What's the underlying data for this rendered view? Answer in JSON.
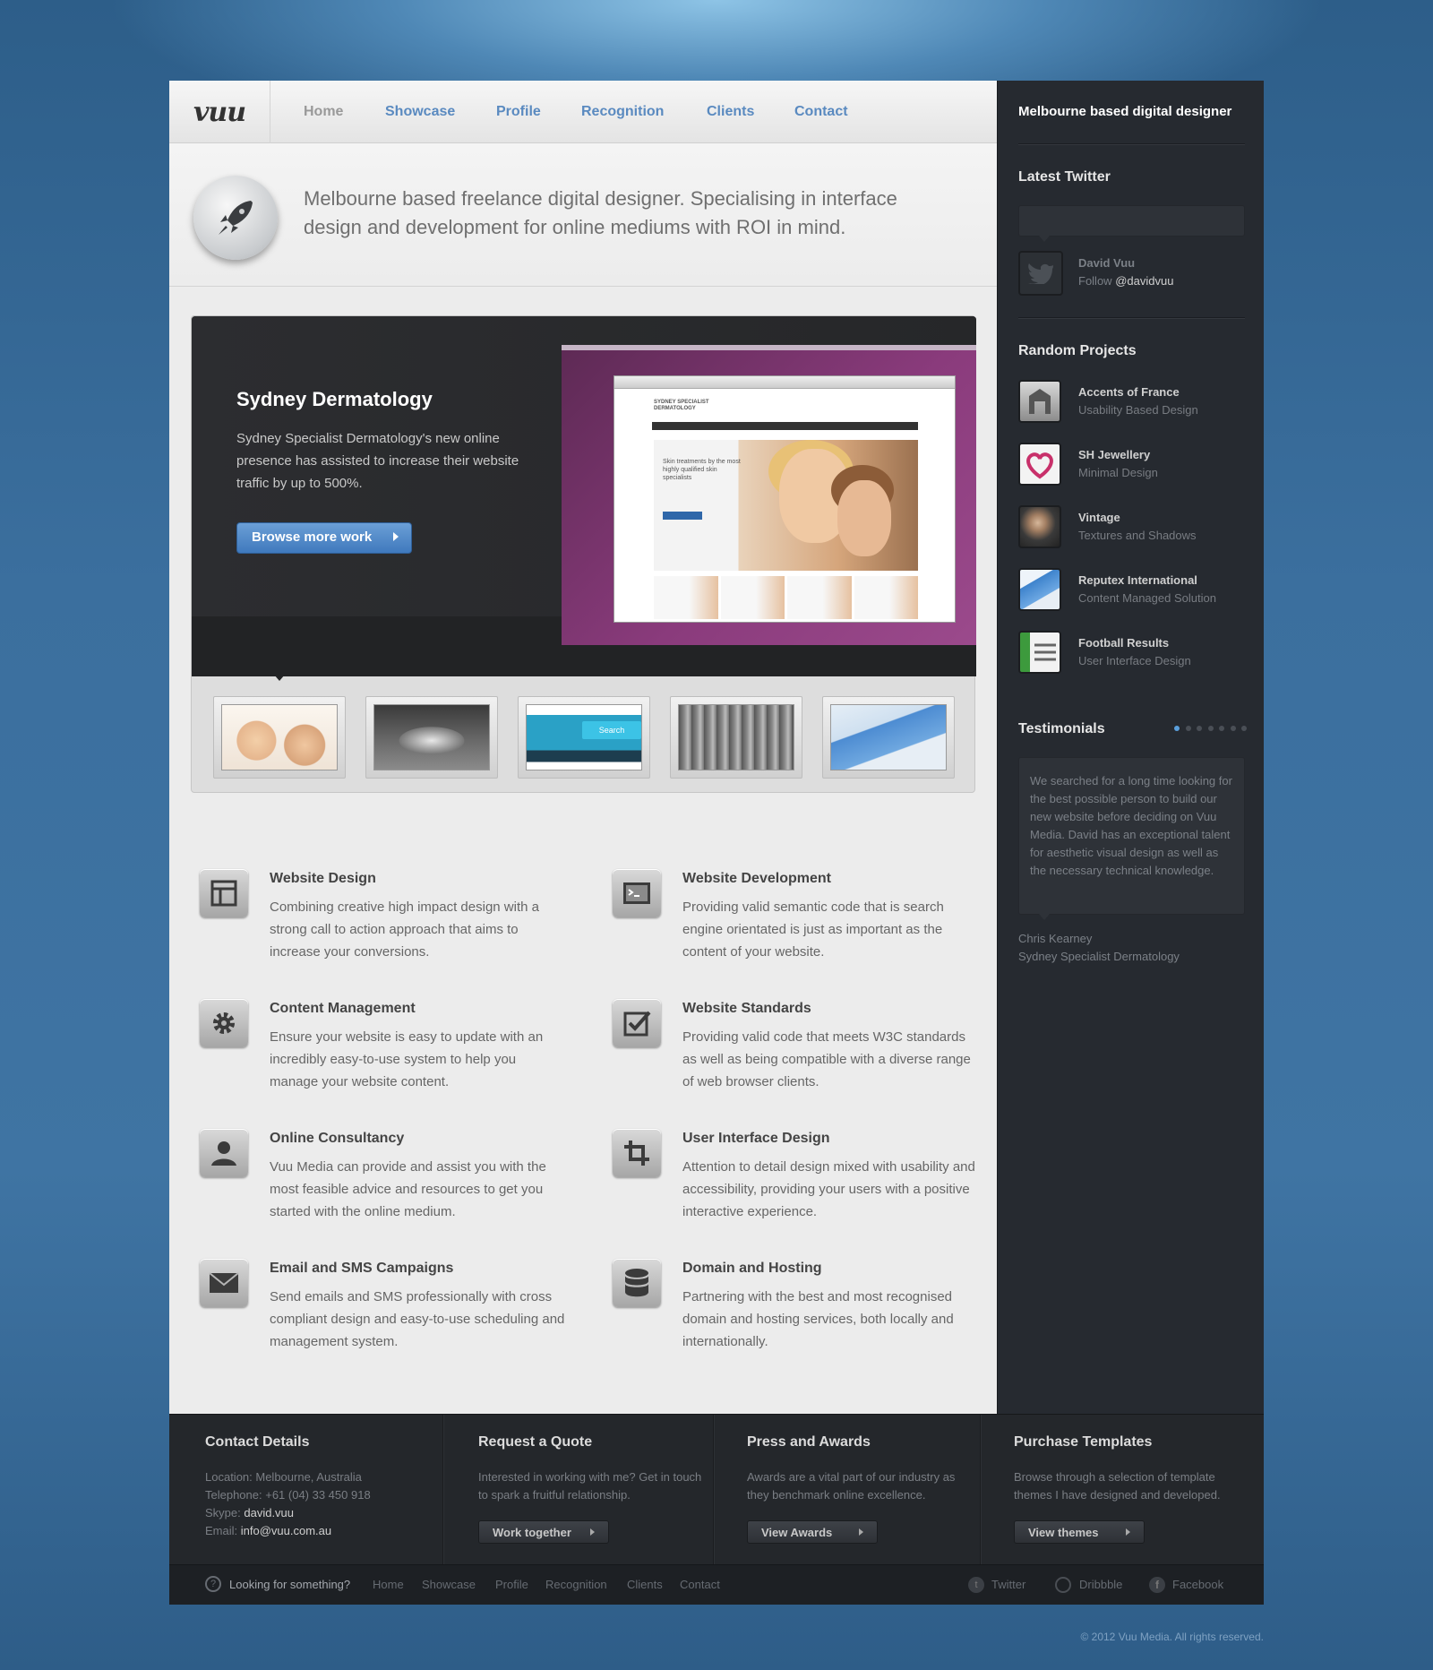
{
  "header": {
    "logo": "vuu",
    "nav": [
      "Home",
      "Showcase",
      "Profile",
      "Recognition",
      "Clients",
      "Contact"
    ]
  },
  "intro": {
    "text": "Melbourne based freelance digital designer. Specialising in interface design and development for online mediums with ROI in mind."
  },
  "feature": {
    "title": "Sydney Dermatology",
    "description": "Sydney Specialist Dermatology's new online presence has assisted to increase their website traffic by up to 500%.",
    "button": "Browse more work",
    "screenshot": {
      "brand": "SYDNEY SPECIALIST DERMATOLOGY",
      "tagline": "Skin treatments by the most highly qualified skin specialists"
    },
    "thumb_search_label": "Search"
  },
  "services": [
    {
      "title": "Website Design",
      "text": "Combining creative high impact design with a strong call to action approach that aims to increase your conversions.",
      "icon": "layout-icon"
    },
    {
      "title": "Website Development",
      "text": "Providing valid semantic code that is search engine orientated is just as important as the content of your website.",
      "icon": "terminal-icon"
    },
    {
      "title": "Content Management",
      "text": "Ensure your website is easy to update with an incredibly easy-to-use system to help you manage your website content.",
      "icon": "gear-icon"
    },
    {
      "title": "Website Standards",
      "text": "Providing valid code that meets W3C standards as well as being compatible with a diverse range of web browser clients.",
      "icon": "checkbox-icon"
    },
    {
      "title": "Online Consultancy",
      "text": "Vuu Media can provide and assist you with the most feasible advice and resources to get you started with the online medium.",
      "icon": "person-icon"
    },
    {
      "title": "User Interface Design",
      "text": "Attention to detail design mixed with usability and accessibility, providing your users with a positive interactive experience.",
      "icon": "crop-icon"
    },
    {
      "title": "Email and SMS Campaigns",
      "text": "Send emails and SMS professionally with cross compliant design and easy-to-use scheduling and management system.",
      "icon": "envelope-icon"
    },
    {
      "title": "Domain and Hosting",
      "text": "Partnering with the best and most recognised domain and hosting services, both locally and internationally.",
      "icon": "database-icon"
    }
  ],
  "sidebar": {
    "tagline": "Melbourne based digital designer",
    "twitter_heading": "Latest Twitter",
    "twitter_name": "David Vuu",
    "twitter_follow_prefix": "Follow ",
    "twitter_handle": "@davidvuu",
    "projects_heading": "Random Projects",
    "projects": [
      {
        "name": "Accents of France",
        "type": "Usability Based Design"
      },
      {
        "name": "SH Jewellery",
        "type": "Minimal Design"
      },
      {
        "name": "Vintage",
        "type": "Textures and Shadows"
      },
      {
        "name": "Reputex International",
        "type": "Content Managed Solution"
      },
      {
        "name": "Football Results",
        "type": "User Interface Design"
      }
    ],
    "testimonials_heading": "Testimonials",
    "testimonial_text": "We searched for a long time looking for the best possible person to build our new website before deciding on Vuu Media. David has an exceptional talent for aesthetic visual design as well as the necessary technical knowledge.",
    "testimonial_author": "Chris Kearney",
    "testimonial_company": "Sydney Specialist Dermatology",
    "testimonial_pages": 7,
    "testimonial_active": 1
  },
  "footer": {
    "contact": {
      "heading": "Contact Details",
      "location": "Location: Melbourne, Australia",
      "telephone": "Telephone: +61 (04) 33 450 918",
      "skype_label": "Skype: ",
      "skype": "david.vuu",
      "email_label": "Email: ",
      "email": "info@vuu.com.au"
    },
    "quote": {
      "heading": "Request a Quote",
      "text": "Interested in working with me? Get in touch to spark a fruitful relationship.",
      "button": "Work together"
    },
    "press": {
      "heading": "Press and Awards",
      "text": "Awards are a vital part of our industry as they benchmark online excellence.",
      "button": "View Awards"
    },
    "templates": {
      "heading": "Purchase Templates",
      "text": "Browse through a selection of template themes I have designed and developed.",
      "button": "View themes"
    }
  },
  "subfooter": {
    "search_label": "Looking for something?",
    "links": [
      "Home",
      "Showcase",
      "Profile",
      "Recognition",
      "Clients",
      "Contact"
    ],
    "social": [
      "Twitter",
      "Dribbble",
      "Facebook"
    ]
  },
  "copyright": "© 2012 Vuu Media. All rights reserved.",
  "colors": {
    "accent": "#5a8ac0",
    "sidebar": "#262a30",
    "button": "#4a85c6"
  }
}
